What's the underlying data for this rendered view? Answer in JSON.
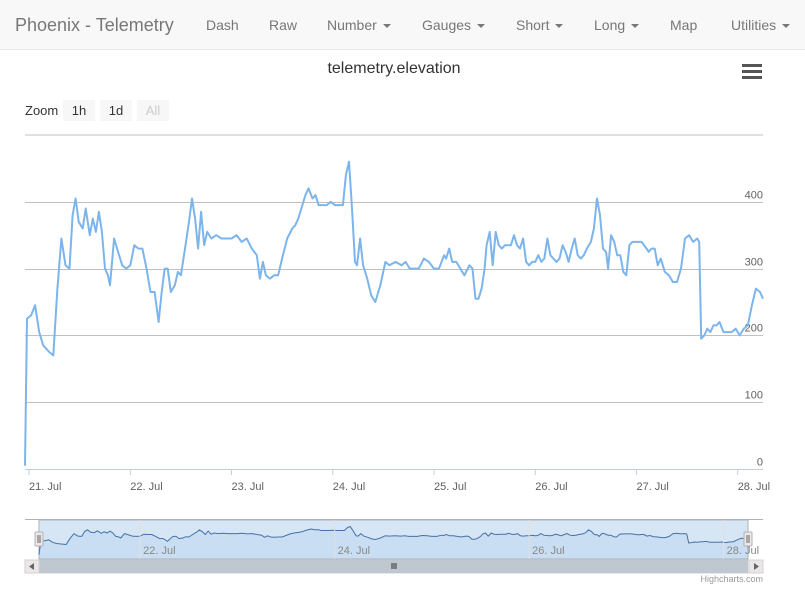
{
  "nav": {
    "brand": "Phoenix - Telemetry",
    "items": [
      {
        "label": "Dash",
        "dropdown": false
      },
      {
        "label": "Raw",
        "dropdown": false
      },
      {
        "label": "Number",
        "dropdown": true
      },
      {
        "label": "Gauges",
        "dropdown": true
      },
      {
        "label": "Short",
        "dropdown": true
      },
      {
        "label": "Long",
        "dropdown": true
      },
      {
        "label": "Map",
        "dropdown": false
      },
      {
        "label": "Utilities",
        "dropdown": true
      }
    ]
  },
  "zoom": {
    "label": "Zoom",
    "buttons": [
      {
        "label": "1h",
        "enabled": true
      },
      {
        "label": "1d",
        "enabled": true
      },
      {
        "label": "All",
        "enabled": false
      }
    ]
  },
  "credit": "Highcharts.com",
  "colors": {
    "series": "#7cb5ec",
    "grid": "#c0c0c0",
    "navigator_fill": "#c6dbef"
  },
  "chart_data": {
    "type": "line",
    "title": "telemetry.elevation",
    "xlabel": "",
    "ylabel": "",
    "ylim": [
      0,
      500
    ],
    "yticks": [
      0,
      100,
      200,
      300,
      400
    ],
    "xlim_days": [
      20.96,
      28.25
    ],
    "xticks": [
      {
        "label": "21. Jul",
        "day": 21
      },
      {
        "label": "22. Jul",
        "day": 22
      },
      {
        "label": "23. Jul",
        "day": 23
      },
      {
        "label": "24. Jul",
        "day": 24
      },
      {
        "label": "25. Jul",
        "day": 25
      },
      {
        "label": "26. Jul",
        "day": 26
      },
      {
        "label": "27. Jul",
        "day": 27
      },
      {
        "label": "28. Jul",
        "day": 28
      }
    ],
    "navigator_ticks": [
      {
        "label": "22. Jul",
        "day": 22
      },
      {
        "label": "24. Jul",
        "day": 24
      },
      {
        "label": "26. Jul",
        "day": 26
      },
      {
        "label": "28. Jul",
        "day": 28
      }
    ],
    "grid": true,
    "legend": "none",
    "series": [
      {
        "points": [
          [
            20.96,
            5
          ],
          [
            20.98,
            225
          ],
          [
            21.02,
            230
          ],
          [
            21.06,
            245
          ],
          [
            21.1,
            205
          ],
          [
            21.14,
            185
          ],
          [
            21.2,
            175
          ],
          [
            21.24,
            170
          ],
          [
            21.28,
            270
          ],
          [
            21.32,
            345
          ],
          [
            21.36,
            305
          ],
          [
            21.4,
            300
          ],
          [
            21.43,
            380
          ],
          [
            21.46,
            405
          ],
          [
            21.49,
            370
          ],
          [
            21.53,
            360
          ],
          [
            21.56,
            390
          ],
          [
            21.6,
            350
          ],
          [
            21.63,
            375
          ],
          [
            21.66,
            355
          ],
          [
            21.69,
            385
          ],
          [
            21.72,
            355
          ],
          [
            21.75,
            300
          ],
          [
            21.78,
            290
          ],
          [
            21.8,
            275
          ],
          [
            21.84,
            345
          ],
          [
            21.88,
            325
          ],
          [
            21.92,
            305
          ],
          [
            21.96,
            300
          ],
          [
            22.0,
            305
          ],
          [
            22.04,
            335
          ],
          [
            22.08,
            330
          ],
          [
            22.12,
            330
          ],
          [
            22.16,
            300
          ],
          [
            22.2,
            265
          ],
          [
            22.24,
            265
          ],
          [
            22.28,
            220
          ],
          [
            22.31,
            265
          ],
          [
            22.34,
            300
          ],
          [
            22.37,
            300
          ],
          [
            22.4,
            265
          ],
          [
            22.44,
            275
          ],
          [
            22.47,
            295
          ],
          [
            22.5,
            290
          ],
          [
            22.54,
            330
          ],
          [
            22.58,
            370
          ],
          [
            22.61,
            405
          ],
          [
            22.64,
            375
          ],
          [
            22.67,
            330
          ],
          [
            22.7,
            385
          ],
          [
            22.73,
            335
          ],
          [
            22.76,
            355
          ],
          [
            22.8,
            345
          ],
          [
            22.85,
            350
          ],
          [
            22.9,
            345
          ],
          [
            22.95,
            345
          ],
          [
            23.0,
            345
          ],
          [
            23.05,
            350
          ],
          [
            23.1,
            340
          ],
          [
            23.15,
            345
          ],
          [
            23.2,
            330
          ],
          [
            23.25,
            320
          ],
          [
            23.28,
            285
          ],
          [
            23.31,
            310
          ],
          [
            23.34,
            290
          ],
          [
            23.38,
            285
          ],
          [
            23.42,
            290
          ],
          [
            23.46,
            290
          ],
          [
            23.5,
            315
          ],
          [
            23.55,
            345
          ],
          [
            23.6,
            360
          ],
          [
            23.63,
            365
          ],
          [
            23.66,
            375
          ],
          [
            23.7,
            395
          ],
          [
            23.73,
            410
          ],
          [
            23.76,
            420
          ],
          [
            23.8,
            405
          ],
          [
            23.83,
            410
          ],
          [
            23.86,
            395
          ],
          [
            23.9,
            395
          ],
          [
            23.94,
            395
          ],
          [
            23.98,
            400
          ],
          [
            24.02,
            395
          ],
          [
            24.06,
            395
          ],
          [
            24.1,
            395
          ],
          [
            24.13,
            440
          ],
          [
            24.16,
            460
          ],
          [
            24.19,
            390
          ],
          [
            24.22,
            310
          ],
          [
            24.24,
            305
          ],
          [
            24.27,
            345
          ],
          [
            24.3,
            305
          ],
          [
            24.34,
            285
          ],
          [
            24.38,
            260
          ],
          [
            24.42,
            250
          ],
          [
            24.47,
            275
          ],
          [
            24.52,
            310
          ],
          [
            24.56,
            305
          ],
          [
            24.62,
            310
          ],
          [
            24.68,
            305
          ],
          [
            24.72,
            310
          ],
          [
            24.76,
            300
          ],
          [
            24.8,
            300
          ],
          [
            24.85,
            300
          ],
          [
            24.9,
            315
          ],
          [
            24.95,
            310
          ],
          [
            25.0,
            300
          ],
          [
            25.05,
            300
          ],
          [
            25.1,
            320
          ],
          [
            25.12,
            315
          ],
          [
            25.15,
            330
          ],
          [
            25.18,
            310
          ],
          [
            25.22,
            310
          ],
          [
            25.26,
            300
          ],
          [
            25.3,
            290
          ],
          [
            25.35,
            305
          ],
          [
            25.38,
            300
          ],
          [
            25.41,
            255
          ],
          [
            25.44,
            255
          ],
          [
            25.47,
            270
          ],
          [
            25.5,
            300
          ],
          [
            25.52,
            335
          ],
          [
            25.55,
            355
          ],
          [
            25.58,
            305
          ],
          [
            25.61,
            355
          ],
          [
            25.64,
            335
          ],
          [
            25.67,
            330
          ],
          [
            25.7,
            335
          ],
          [
            25.73,
            335
          ],
          [
            25.76,
            335
          ],
          [
            25.79,
            350
          ],
          [
            25.82,
            335
          ],
          [
            25.85,
            330
          ],
          [
            25.88,
            345
          ],
          [
            25.91,
            310
          ],
          [
            25.94,
            305
          ],
          [
            25.97,
            310
          ],
          [
            26.0,
            310
          ],
          [
            26.03,
            320
          ],
          [
            26.06,
            310
          ],
          [
            26.09,
            315
          ],
          [
            26.12,
            345
          ],
          [
            26.15,
            320
          ],
          [
            26.18,
            315
          ],
          [
            26.21,
            310
          ],
          [
            26.24,
            315
          ],
          [
            26.27,
            335
          ],
          [
            26.3,
            325
          ],
          [
            26.33,
            310
          ],
          [
            26.36,
            330
          ],
          [
            26.39,
            345
          ],
          [
            26.42,
            320
          ],
          [
            26.45,
            315
          ],
          [
            26.48,
            320
          ],
          [
            26.51,
            330
          ],
          [
            26.55,
            340
          ],
          [
            26.58,
            360
          ],
          [
            26.61,
            405
          ],
          [
            26.64,
            380
          ],
          [
            26.67,
            330
          ],
          [
            26.7,
            325
          ],
          [
            26.72,
            300
          ],
          [
            26.75,
            350
          ],
          [
            26.78,
            340
          ],
          [
            26.81,
            320
          ],
          [
            26.84,
            320
          ],
          [
            26.87,
            295
          ],
          [
            26.9,
            290
          ],
          [
            26.93,
            335
          ],
          [
            26.96,
            340
          ],
          [
            27.0,
            340
          ],
          [
            27.05,
            340
          ],
          [
            27.1,
            330
          ],
          [
            27.12,
            325
          ],
          [
            27.15,
            330
          ],
          [
            27.18,
            330
          ],
          [
            27.21,
            305
          ],
          [
            27.24,
            315
          ],
          [
            27.28,
            295
          ],
          [
            27.32,
            290
          ],
          [
            27.36,
            280
          ],
          [
            27.4,
            280
          ],
          [
            27.44,
            300
          ],
          [
            27.48,
            345
          ],
          [
            27.52,
            350
          ],
          [
            27.56,
            340
          ],
          [
            27.6,
            345
          ],
          [
            27.62,
            340
          ],
          [
            27.64,
            195
          ],
          [
            27.67,
            200
          ],
          [
            27.7,
            210
          ],
          [
            27.73,
            205
          ],
          [
            27.76,
            215
          ],
          [
            27.79,
            215
          ],
          [
            27.82,
            220
          ],
          [
            27.86,
            205
          ],
          [
            27.9,
            205
          ],
          [
            27.94,
            205
          ],
          [
            27.98,
            210
          ],
          [
            28.02,
            200
          ],
          [
            28.06,
            210
          ],
          [
            28.1,
            215
          ],
          [
            28.14,
            245
          ],
          [
            28.18,
            270
          ],
          [
            28.22,
            265
          ],
          [
            28.25,
            255
          ]
        ]
      }
    ]
  }
}
